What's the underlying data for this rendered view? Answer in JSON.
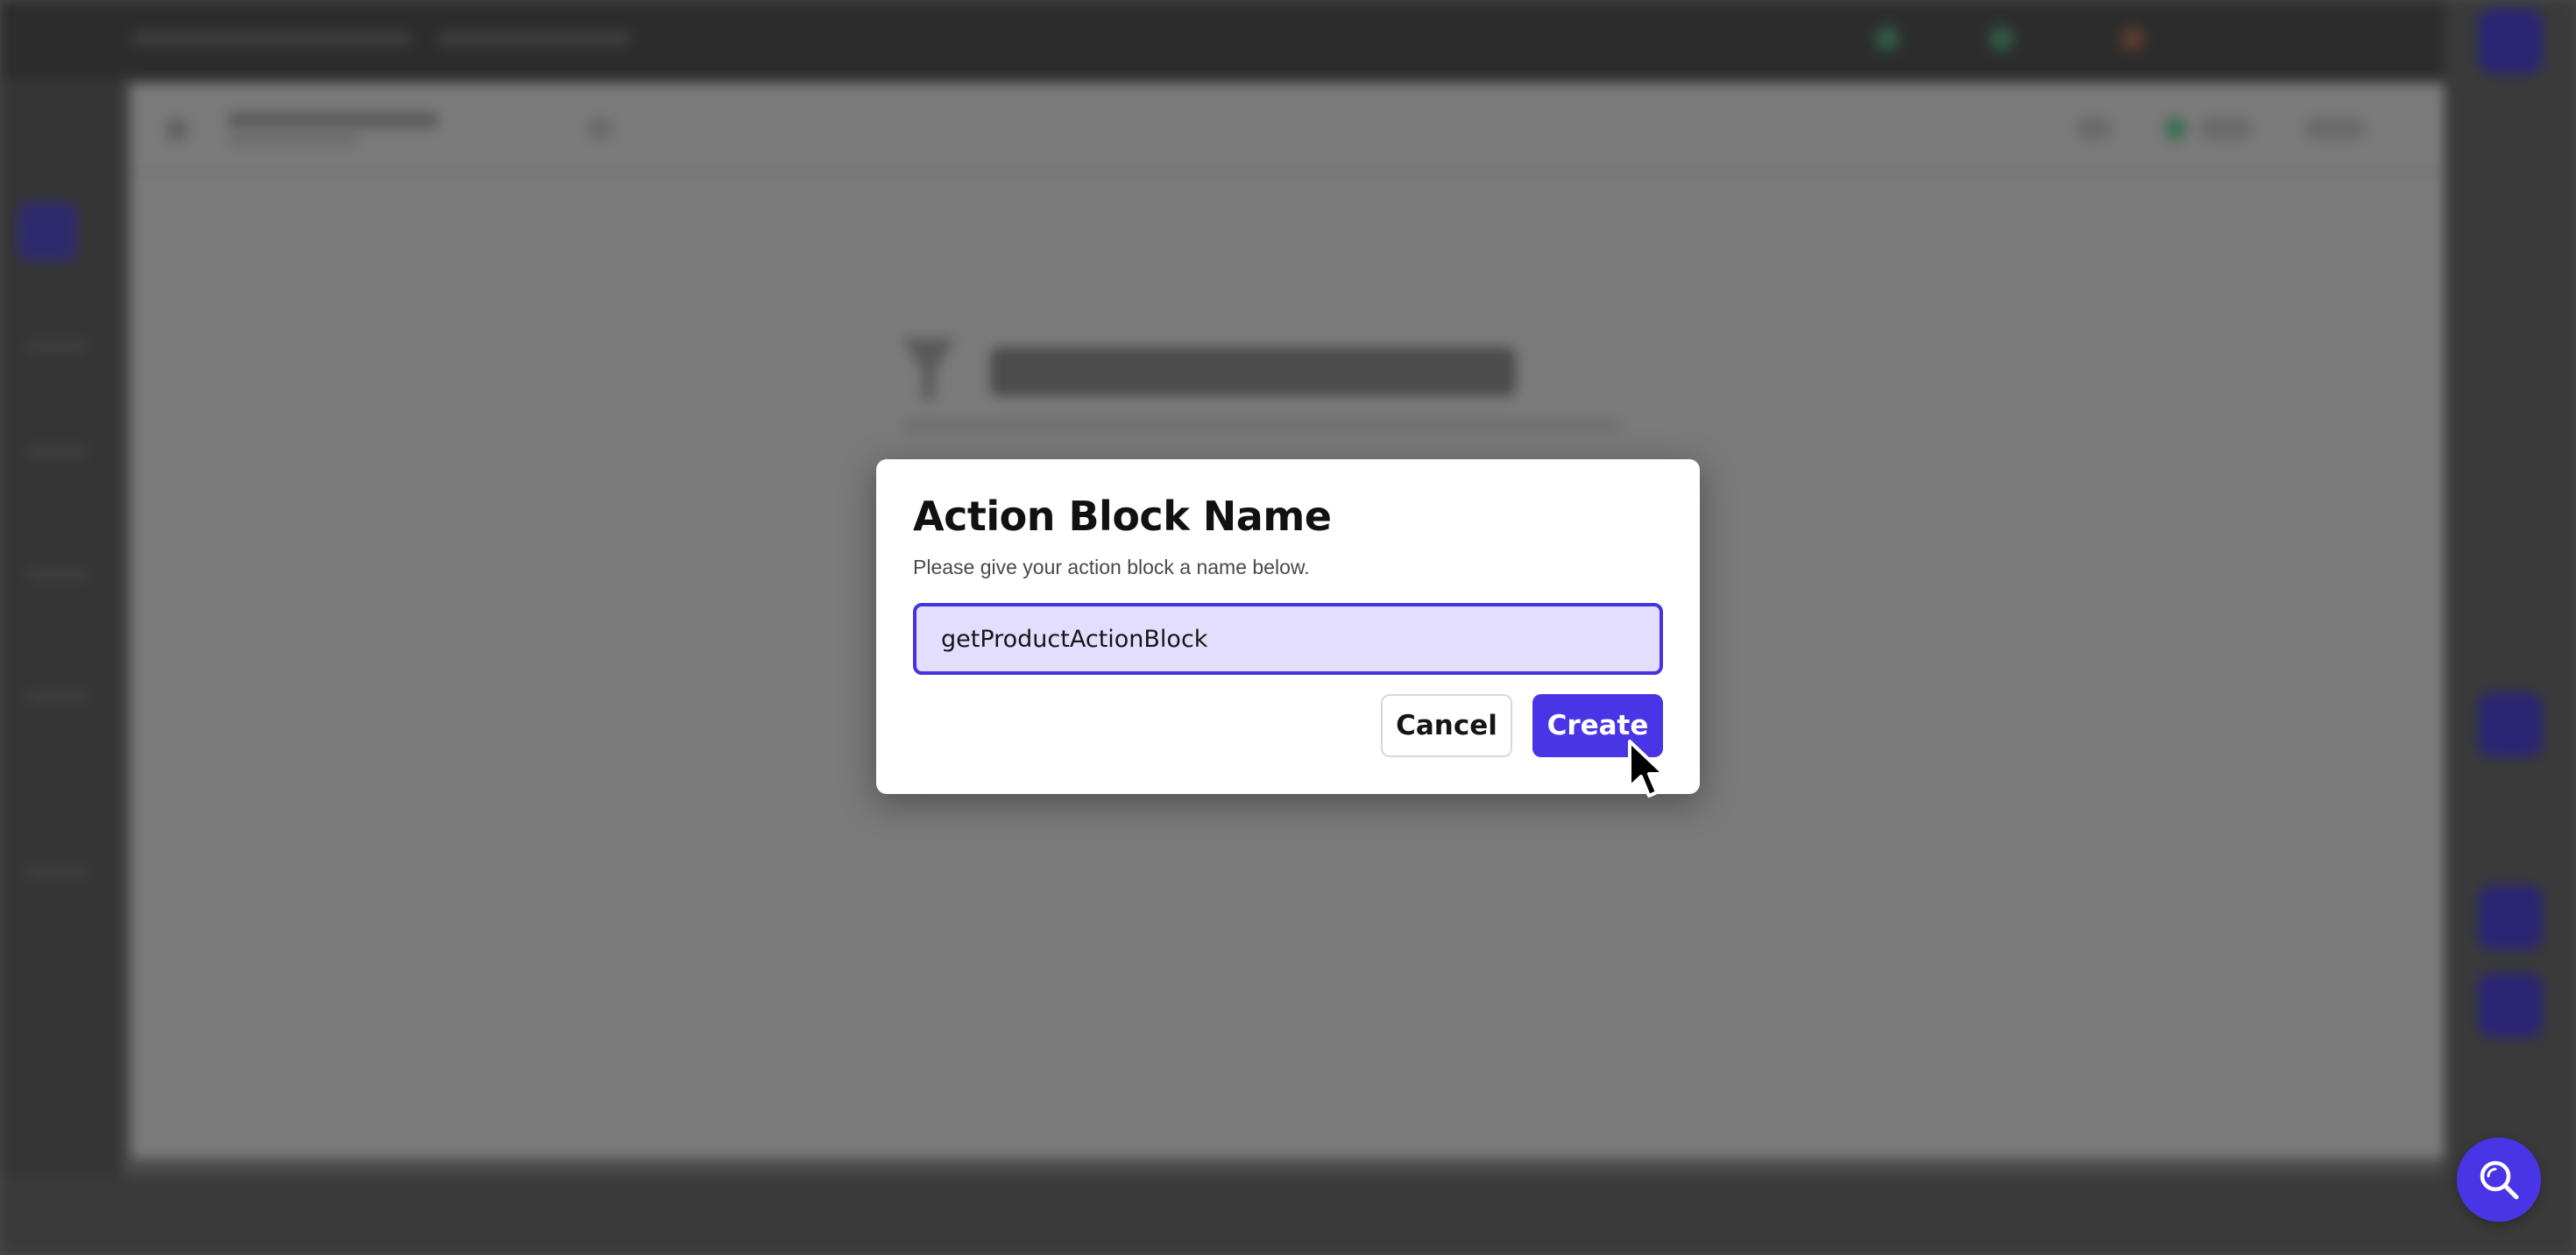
{
  "dialog": {
    "title": "Action Block Name",
    "subtitle": "Please give your action block a name below.",
    "name_input": {
      "value": "getProductActionBlock",
      "placeholder": ""
    },
    "cancel_label": "Cancel",
    "create_label": "Create"
  },
  "background": {
    "note": ""
  },
  "icons": {
    "search_fab": "search-icon",
    "cursor": "cursor-arrow-icon",
    "background_heading": "funnel-icon"
  },
  "colors": {
    "accent": "#4a35e6",
    "input_fill": "#e3defd",
    "overlay": "#4a4a4a"
  }
}
